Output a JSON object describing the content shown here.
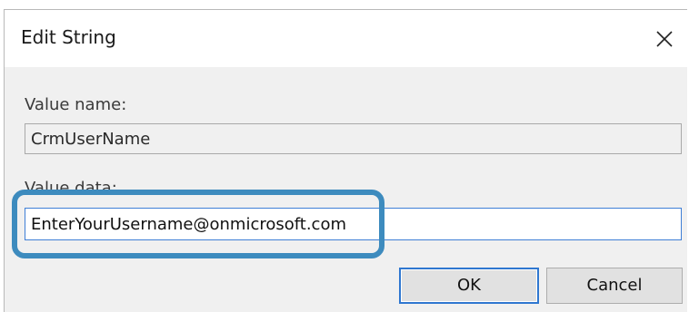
{
  "window": {
    "title": "Edit String",
    "close_icon": "close-icon"
  },
  "value_name": {
    "label": "Value name:",
    "value": "CrmUserName"
  },
  "value_data": {
    "label": "Value data:",
    "value": "EnterYourUsername@onmicrosoft.com"
  },
  "buttons": {
    "ok": "OK",
    "cancel": "Cancel"
  },
  "colors": {
    "highlight_outline": "#3d8bbe",
    "focus_border": "#3f7fd6",
    "dialog_background": "#f0f0f0"
  }
}
